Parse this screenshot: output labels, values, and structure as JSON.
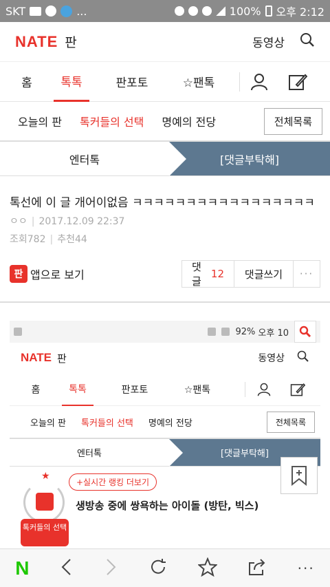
{
  "status_bar": {
    "carrier": "SKT",
    "more": "...",
    "battery": "100%",
    "time": "오후 2:12"
  },
  "header": {
    "logo": "NATE",
    "logo_sub": "판",
    "video_label": "동영상"
  },
  "main_tabs": [
    "홈",
    "톡톡",
    "판포토",
    "☆팬톡"
  ],
  "sub_tabs": [
    "오늘의 판",
    "톡커들의 선택",
    "명예의 전당"
  ],
  "all_list_label": "전체목록",
  "category": {
    "left": "엔터톡",
    "right": "[댓글부탁해]"
  },
  "post": {
    "title": "톡선에 이 글 개어이없음 ㅋㅋㅋㅋㅋㅋㅋㅋㅋㅋㅋㅋㅋㅋㅋㅋㅋ",
    "author": "ㅇㅇ",
    "date": "2017.12.09 22:37",
    "views": "조회782",
    "likes": "추천44"
  },
  "actions": {
    "app_badge": "판",
    "app_label": "앱으로 보기",
    "comment_label": "댓글",
    "comment_count": "12",
    "write_comment": "댓글쓰기",
    "more": "···"
  },
  "embedded": {
    "status": {
      "battery": "92%",
      "time": "오후 10"
    },
    "header": {
      "logo": "NATE",
      "logo_sub": "판",
      "video_label": "동영상"
    },
    "tabs": [
      "홈",
      "톡톡",
      "판포토",
      "☆팬톡"
    ],
    "sub_tabs": [
      "오늘의 판",
      "톡커들의 선택",
      "명예의 전당"
    ],
    "all_list_label": "전체목록",
    "category": {
      "left": "엔터톡",
      "right": "[댓글부탁해]"
    },
    "rank_button": "+실시간 랭킹 더보기",
    "rank_title": "생방송 중에 쌍욕하는 아이돌 (방탄, 빅스)",
    "badge_text": "톡커들의 선택"
  },
  "bottom_nav": {
    "n_logo": "N",
    "more": "···"
  }
}
